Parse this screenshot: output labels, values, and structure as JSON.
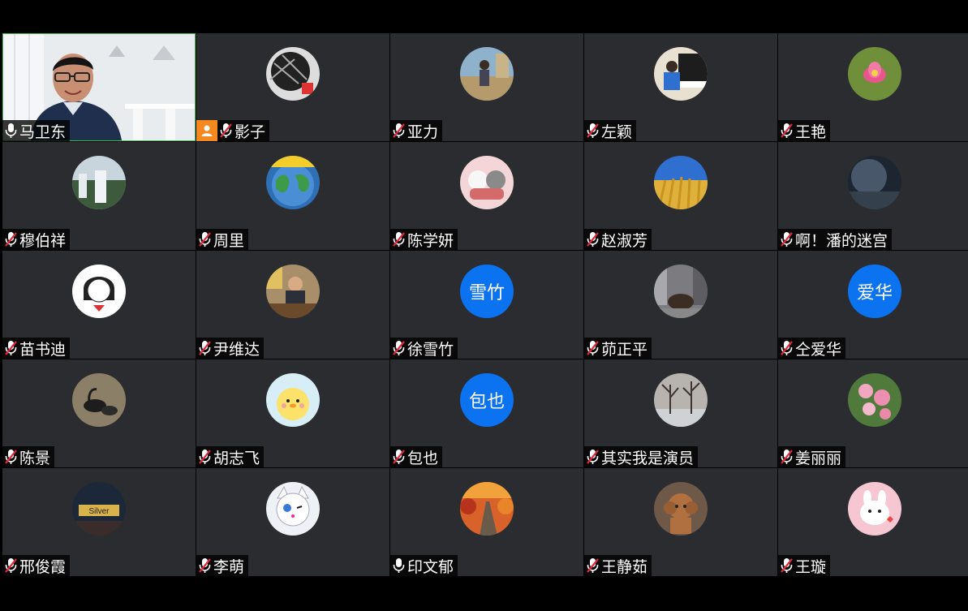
{
  "meeting": {
    "participants": [
      {
        "name": "马卫东",
        "muted": false,
        "video": true,
        "active_speaker": true,
        "host_badge": false,
        "avatar": "video-feed"
      },
      {
        "name": "影子",
        "muted": true,
        "video": false,
        "host_badge": true,
        "avatar": "photo-dark-abstract"
      },
      {
        "name": "亚力",
        "muted": true,
        "video": false,
        "host_badge": false,
        "avatar": "photo-person-outdoor"
      },
      {
        "name": "左颖",
        "muted": true,
        "video": false,
        "host_badge": false,
        "avatar": "photo-child-piano"
      },
      {
        "name": "王艳",
        "muted": true,
        "video": false,
        "host_badge": false,
        "avatar": "photo-lotus-flower"
      },
      {
        "name": "穆伯祥",
        "muted": true,
        "video": false,
        "host_badge": false,
        "avatar": "photo-waterfall"
      },
      {
        "name": "周里",
        "muted": true,
        "video": false,
        "host_badge": false,
        "avatar": "photo-cartoon-earth"
      },
      {
        "name": "陈学妍",
        "muted": true,
        "video": false,
        "host_badge": false,
        "avatar": "photo-cartoon-dogs"
      },
      {
        "name": "赵淑芳",
        "muted": true,
        "video": false,
        "host_badge": false,
        "avatar": "photo-wheat-field"
      },
      {
        "name": "啊！潘的迷宫",
        "muted": true,
        "video": false,
        "host_badge": false,
        "avatar": "photo-moon-night"
      },
      {
        "name": "苗书迪",
        "muted": true,
        "video": false,
        "host_badge": false,
        "avatar": "photo-cartoon-girl"
      },
      {
        "name": "尹维达",
        "muted": true,
        "video": false,
        "host_badge": false,
        "avatar": "photo-man-desk"
      },
      {
        "name": "徐雪竹",
        "muted": true,
        "video": false,
        "host_badge": false,
        "avatar_text": "雪竹"
      },
      {
        "name": "茆正平",
        "muted": true,
        "video": false,
        "host_badge": false,
        "avatar": "photo-city-bull"
      },
      {
        "name": "仝爱华",
        "muted": true,
        "video": false,
        "host_badge": false,
        "avatar_text": "爱华"
      },
      {
        "name": "陈景",
        "muted": true,
        "video": false,
        "host_badge": false,
        "avatar": "photo-black-swans"
      },
      {
        "name": "胡志飞",
        "muted": true,
        "video": false,
        "host_badge": false,
        "avatar": "photo-cartoon-chick"
      },
      {
        "name": "包也",
        "muted": true,
        "video": false,
        "host_badge": false,
        "avatar_text": "包也"
      },
      {
        "name": "其实我是演员",
        "muted": true,
        "video": false,
        "host_badge": false,
        "avatar": "photo-winter-trees"
      },
      {
        "name": "姜丽丽",
        "muted": true,
        "video": false,
        "host_badge": false,
        "avatar": "photo-pink-flowers"
      },
      {
        "name": "邢俊霞",
        "muted": true,
        "video": false,
        "host_badge": false,
        "avatar": "photo-sign-night"
      },
      {
        "name": "李萌",
        "muted": true,
        "video": false,
        "host_badge": false,
        "avatar": "photo-cartoon-cat"
      },
      {
        "name": "印文郁",
        "muted": false,
        "video": false,
        "host_badge": false,
        "avatar": "photo-autumn-road"
      },
      {
        "name": "王静茹",
        "muted": true,
        "video": false,
        "host_badge": false,
        "avatar": "photo-poodle"
      },
      {
        "name": "王璇",
        "muted": true,
        "video": false,
        "host_badge": false,
        "avatar": "photo-pink-bunny"
      }
    ]
  },
  "colors": {
    "tile_bg": "#2b2c30",
    "active_border": "#3cc05a",
    "text_avatar_bg": "#0b72f0",
    "host_badge": "#f5891f",
    "muted_slash": "#e0283c"
  }
}
